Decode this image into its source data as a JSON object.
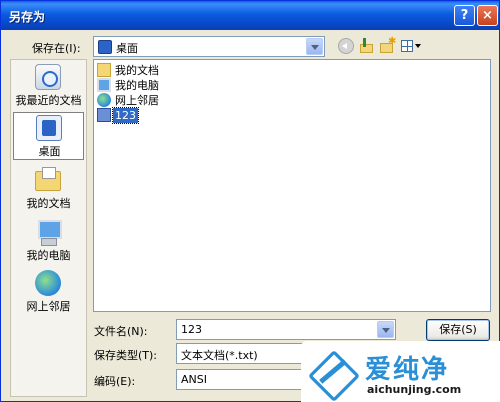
{
  "window": {
    "title": "另存为",
    "help_label": "?",
    "close_label": "×"
  },
  "location": {
    "label": "保存在(I):",
    "value": "桌面"
  },
  "places": [
    {
      "label": "我最近的文档",
      "icon": "recent-documents-icon"
    },
    {
      "label": "桌面",
      "icon": "desktop-icon",
      "selected": true
    },
    {
      "label": "我的文档",
      "icon": "my-documents-icon"
    },
    {
      "label": "我的电脑",
      "icon": "my-computer-icon"
    },
    {
      "label": "网上邻居",
      "icon": "network-places-icon"
    }
  ],
  "files": [
    {
      "name": "我的文档",
      "icon": "folder-icon"
    },
    {
      "name": "我的电脑",
      "icon": "computer-icon"
    },
    {
      "name": "网上邻居",
      "icon": "network-icon"
    },
    {
      "name": "123",
      "icon": "text-file-icon",
      "selected": true
    }
  ],
  "form": {
    "filename_label": "文件名(N):",
    "filename_value": "123",
    "filetype_label": "保存类型(T):",
    "filetype_value": "文本文档(*.txt)",
    "encoding_label": "编码(E):",
    "encoding_value": "ANSI"
  },
  "buttons": {
    "save": "保存(S)"
  },
  "watermark": {
    "brand_cn": "爱纯净",
    "brand_url": "aichunjing.com"
  }
}
